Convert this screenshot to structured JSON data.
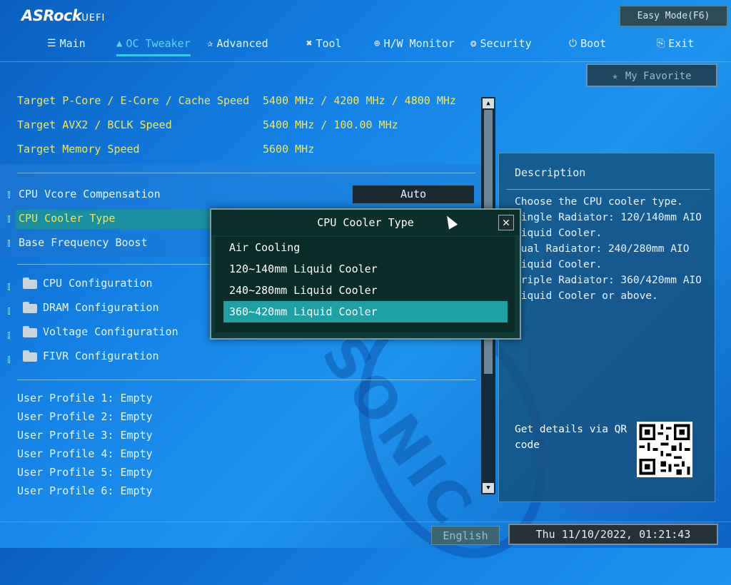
{
  "brand": {
    "logo": "ASRock",
    "logo_suffix": "UEFI"
  },
  "easy_mode_label": "Easy Mode(F6)",
  "nav": [
    {
      "label": "Main",
      "icon": "list-icon",
      "active": false
    },
    {
      "label": "OC Tweaker",
      "icon": "rocket-icon",
      "active": true
    },
    {
      "label": "Advanced",
      "icon": "star-icon",
      "active": false
    },
    {
      "label": "Tool",
      "icon": "tools-icon",
      "active": false
    },
    {
      "label": "H/W Monitor",
      "icon": "globe-icon",
      "active": false
    },
    {
      "label": "Security",
      "icon": "shield-icon",
      "active": false
    },
    {
      "label": "Boot",
      "icon": "power-icon",
      "active": false
    },
    {
      "label": "Exit",
      "icon": "exit-icon",
      "active": false
    }
  ],
  "favorite_label": "My Favorite",
  "targets": [
    {
      "label": "Target P-Core / E-Core / Cache Speed",
      "value": "5400 MHz / 4200 MHz / 4800 MHz"
    },
    {
      "label": "Target AVX2 / BCLK Speed",
      "value": "5400 MHz / 100.00 MHz"
    },
    {
      "label": "Target Memory Speed",
      "value": "5600 MHz"
    }
  ],
  "settings": [
    {
      "label": "CPU Vcore Compensation",
      "value": "Auto"
    },
    {
      "label": "CPU Cooler Type",
      "value": ""
    },
    {
      "label": "Base Frequency Boost",
      "value": ""
    }
  ],
  "folders": [
    {
      "label": "CPU Configuration"
    },
    {
      "label": "DRAM Configuration"
    },
    {
      "label": "Voltage Configuration"
    },
    {
      "label": "FIVR Configuration"
    }
  ],
  "profiles": [
    "User Profile 1: Empty",
    "User Profile 2: Empty",
    "User Profile 3: Empty",
    "User Profile 4: Empty",
    "User Profile 5: Empty",
    "User Profile 6: Empty"
  ],
  "description": {
    "title": "Description",
    "text": "Choose the CPU cooler type.\nSingle Radiator: 120/140mm AIO Liquid Cooler.\nDual Radiator: 240/280mm AIO Liquid Cooler.\nTriple Radiator: 360/420mm AIO Liquid Cooler or above.",
    "qr_label": "Get details via QR code"
  },
  "popup": {
    "title": "CPU Cooler Type",
    "options": [
      "Air Cooling",
      "120~140mm Liquid Cooler",
      "240~280mm Liquid Cooler",
      "360~420mm Liquid Cooler"
    ],
    "selected_index": 3
  },
  "footer": {
    "language": "English",
    "datetime": "Thu 11/10/2022, 01:21:43"
  },
  "background_text": "SONIC",
  "colors": {
    "accent": "#38c8f0",
    "highlight": "#f3e658",
    "selected": "#1fa0a4"
  }
}
